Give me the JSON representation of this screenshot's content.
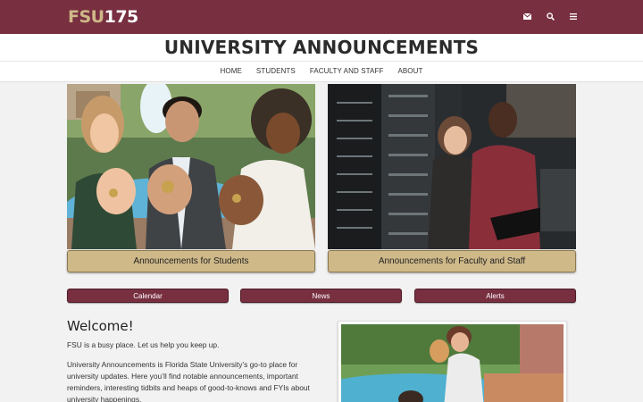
{
  "header": {
    "logo_fsu": "FSU",
    "logo_num": "175",
    "icons": [
      "mail-icon",
      "search-icon",
      "menu-icon"
    ]
  },
  "page": {
    "title": "UNIVERSITY ANNOUNCEMENTS"
  },
  "nav": {
    "items": [
      "HOME",
      "STUDENTS",
      "FACULTY AND STAFF",
      "ABOUT"
    ]
  },
  "cards": [
    {
      "label": "Announcements for Students"
    },
    {
      "label": "Announcements for Faculty and Staff"
    }
  ],
  "buttons": [
    "Calendar",
    "News",
    "Alerts"
  ],
  "welcome": {
    "heading": "Welcome!",
    "intro": "FSU is a busy place. Let us help you keep up.",
    "body": "University Announcements is Florida State University’s go-to place for university updates. Here you’ll find notable announcements, important reminders, interesting tidbits and heaps of good-to-knows and FYIs about university happenings."
  },
  "colors": {
    "garnet": "#782f40",
    "gold": "#ceb888",
    "gold_button": "#cfb989",
    "background": "#f2f2f2"
  }
}
